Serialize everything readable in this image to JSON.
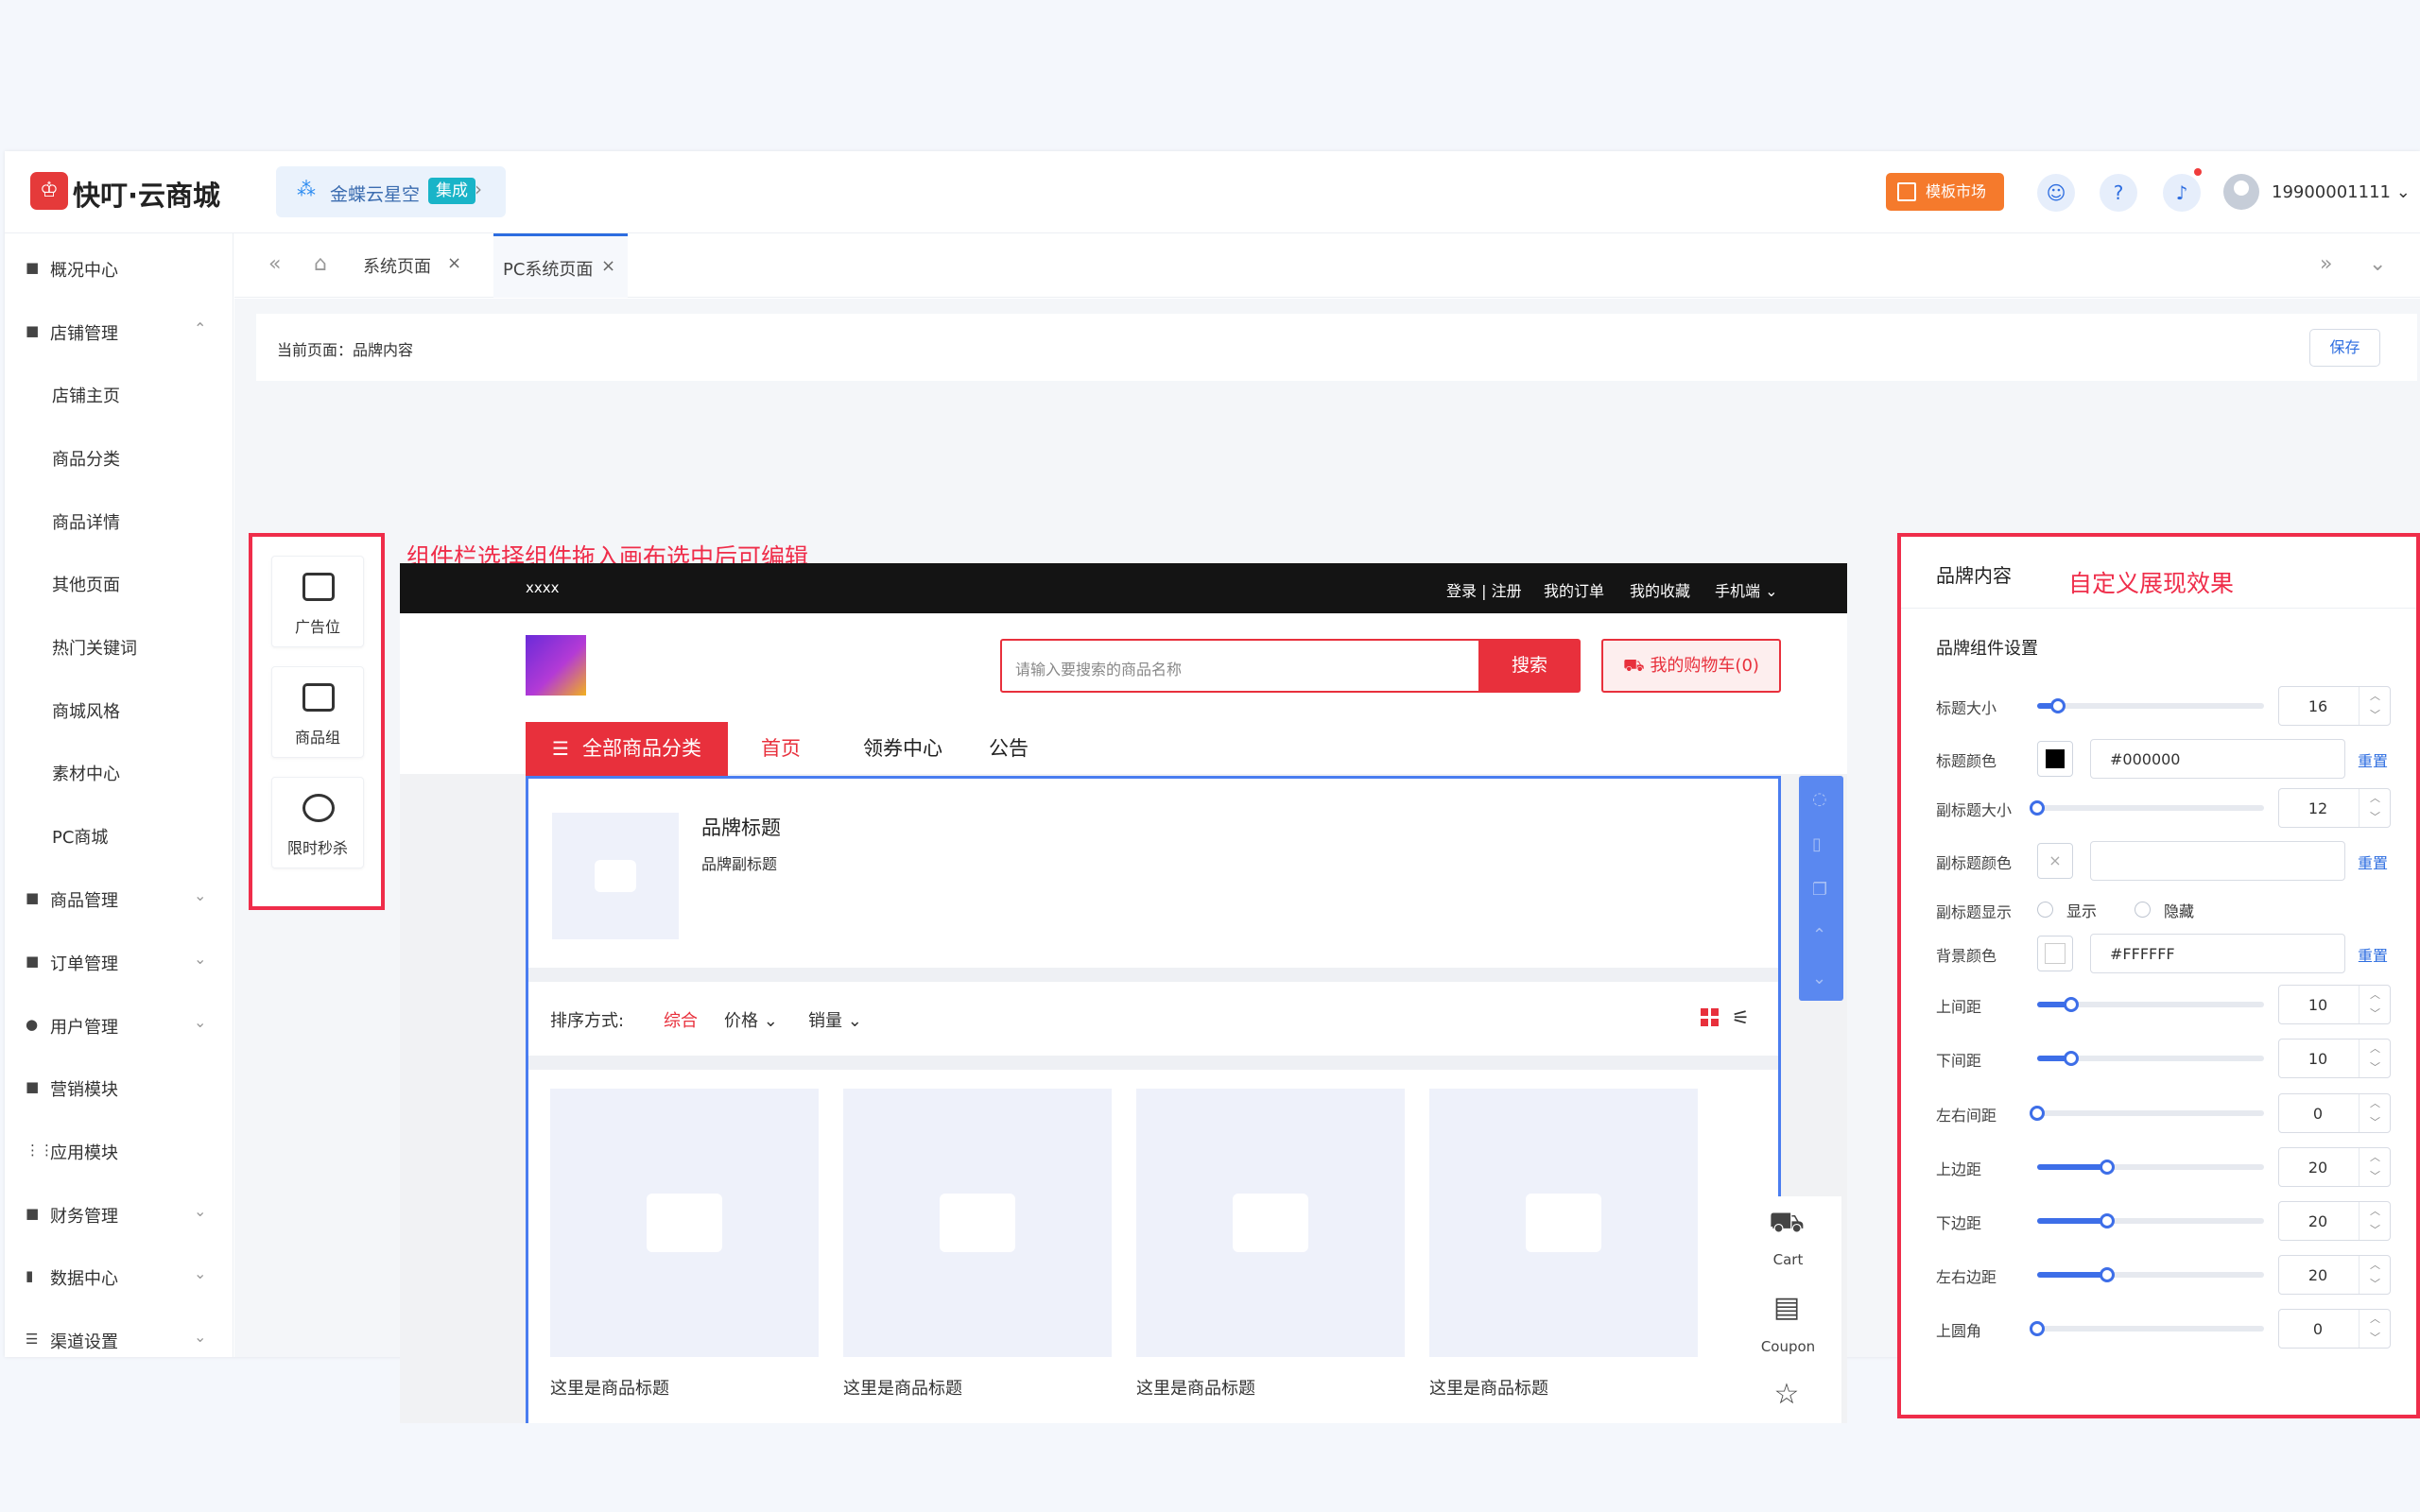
{
  "header": {
    "logo_glyph": "♔",
    "app_name": "快叮·云商城",
    "integration_name": "金蝶云星空",
    "integration_badge": "集成",
    "template_market": "模板市场",
    "username": "19900001111",
    "brand_color": "#e53a3a",
    "accent_color": "#2d6de0"
  },
  "sidebar": {
    "items": [
      {
        "label": "概况中心",
        "icon": "bag-icon"
      },
      {
        "label": "店铺管理",
        "icon": "store-icon"
      },
      {
        "label": "商品管理",
        "icon": "goods-icon"
      },
      {
        "label": "订单管理",
        "icon": "order-icon"
      },
      {
        "label": "用户管理",
        "icon": "user-icon"
      },
      {
        "label": "营销模块",
        "icon": "marketing-icon"
      },
      {
        "label": "应用模块",
        "icon": "apps-icon"
      },
      {
        "label": "财务管理",
        "icon": "finance-icon"
      },
      {
        "label": "数据中心",
        "icon": "chart-icon"
      },
      {
        "label": "渠道设置",
        "icon": "menu-icon"
      }
    ],
    "subitems": [
      "店铺主页",
      "商品分类",
      "商品详情",
      "其他页面",
      "热门关键词",
      "商城风格",
      "素材中心",
      "PC商城"
    ]
  },
  "tabs": [
    {
      "label": "系统页面"
    },
    {
      "label": "PC系统页面"
    }
  ],
  "page": {
    "current_label": "当前页面：品牌内容",
    "save": "保存"
  },
  "palette": {
    "annotation": "组件栏选择组件拖入画布选中后可编辑",
    "items": [
      {
        "label": "广告位",
        "icon": "ad-icon"
      },
      {
        "label": "商品组",
        "icon": "goods-group-icon"
      },
      {
        "label": "限时秒杀",
        "icon": "alarm-clock-icon"
      }
    ]
  },
  "canvas": {
    "site_name": "xxxx",
    "topnav": [
      "登录 | 注册",
      "我的订单",
      "我的收藏",
      "手机端"
    ],
    "search_placeholder": "请输入要搜索的商品名称",
    "search_button": "搜索",
    "cart_button": "我的购物车(0)",
    "category_button": "全部商品分类",
    "nav": [
      "首页",
      "领券中心",
      "公告"
    ],
    "brand_title": "品牌标题",
    "brand_subtitle": "品牌副标题",
    "sort_label": "排序方式:",
    "sort_options": [
      "综合",
      "价格",
      "销量"
    ],
    "products": [
      "这里是商品标题",
      "这里是商品标题",
      "这里是商品标题",
      "这里是商品标题"
    ],
    "side_tools": [
      "Cart",
      "Coupon"
    ]
  },
  "props": {
    "title": "品牌内容",
    "annotation": "自定义展现效果",
    "section": "品牌组件设置",
    "reset": "重置",
    "title_size": {
      "label": "标题大小",
      "value": "16",
      "fraction": 0.09
    },
    "title_color": {
      "label": "标题颜色",
      "value": "#000000"
    },
    "sub_size": {
      "label": "副标题大小",
      "value": "12",
      "fraction": 0.0
    },
    "sub_color": {
      "label": "副标题颜色",
      "value": ""
    },
    "sub_display": {
      "label": "副标题显示",
      "show": "显示",
      "hide": "隐藏"
    },
    "bg_color": {
      "label": "背景颜色",
      "value": "#FFFFFF"
    },
    "top_spacing": {
      "label": "上间距",
      "value": "10",
      "fraction": 0.15
    },
    "bottom_spacing": {
      "label": "下间距",
      "value": "10",
      "fraction": 0.15
    },
    "lr_spacing": {
      "label": "左右间距",
      "value": "0",
      "fraction": 0.0
    },
    "top_margin": {
      "label": "上边距",
      "value": "20",
      "fraction": 0.31
    },
    "bottom_margin": {
      "label": "下边距",
      "value": "20",
      "fraction": 0.31
    },
    "lr_margin": {
      "label": "左右边距",
      "value": "20",
      "fraction": 0.31
    },
    "top_radius": {
      "label": "上圆角",
      "value": "0",
      "fraction": 0.0
    }
  }
}
